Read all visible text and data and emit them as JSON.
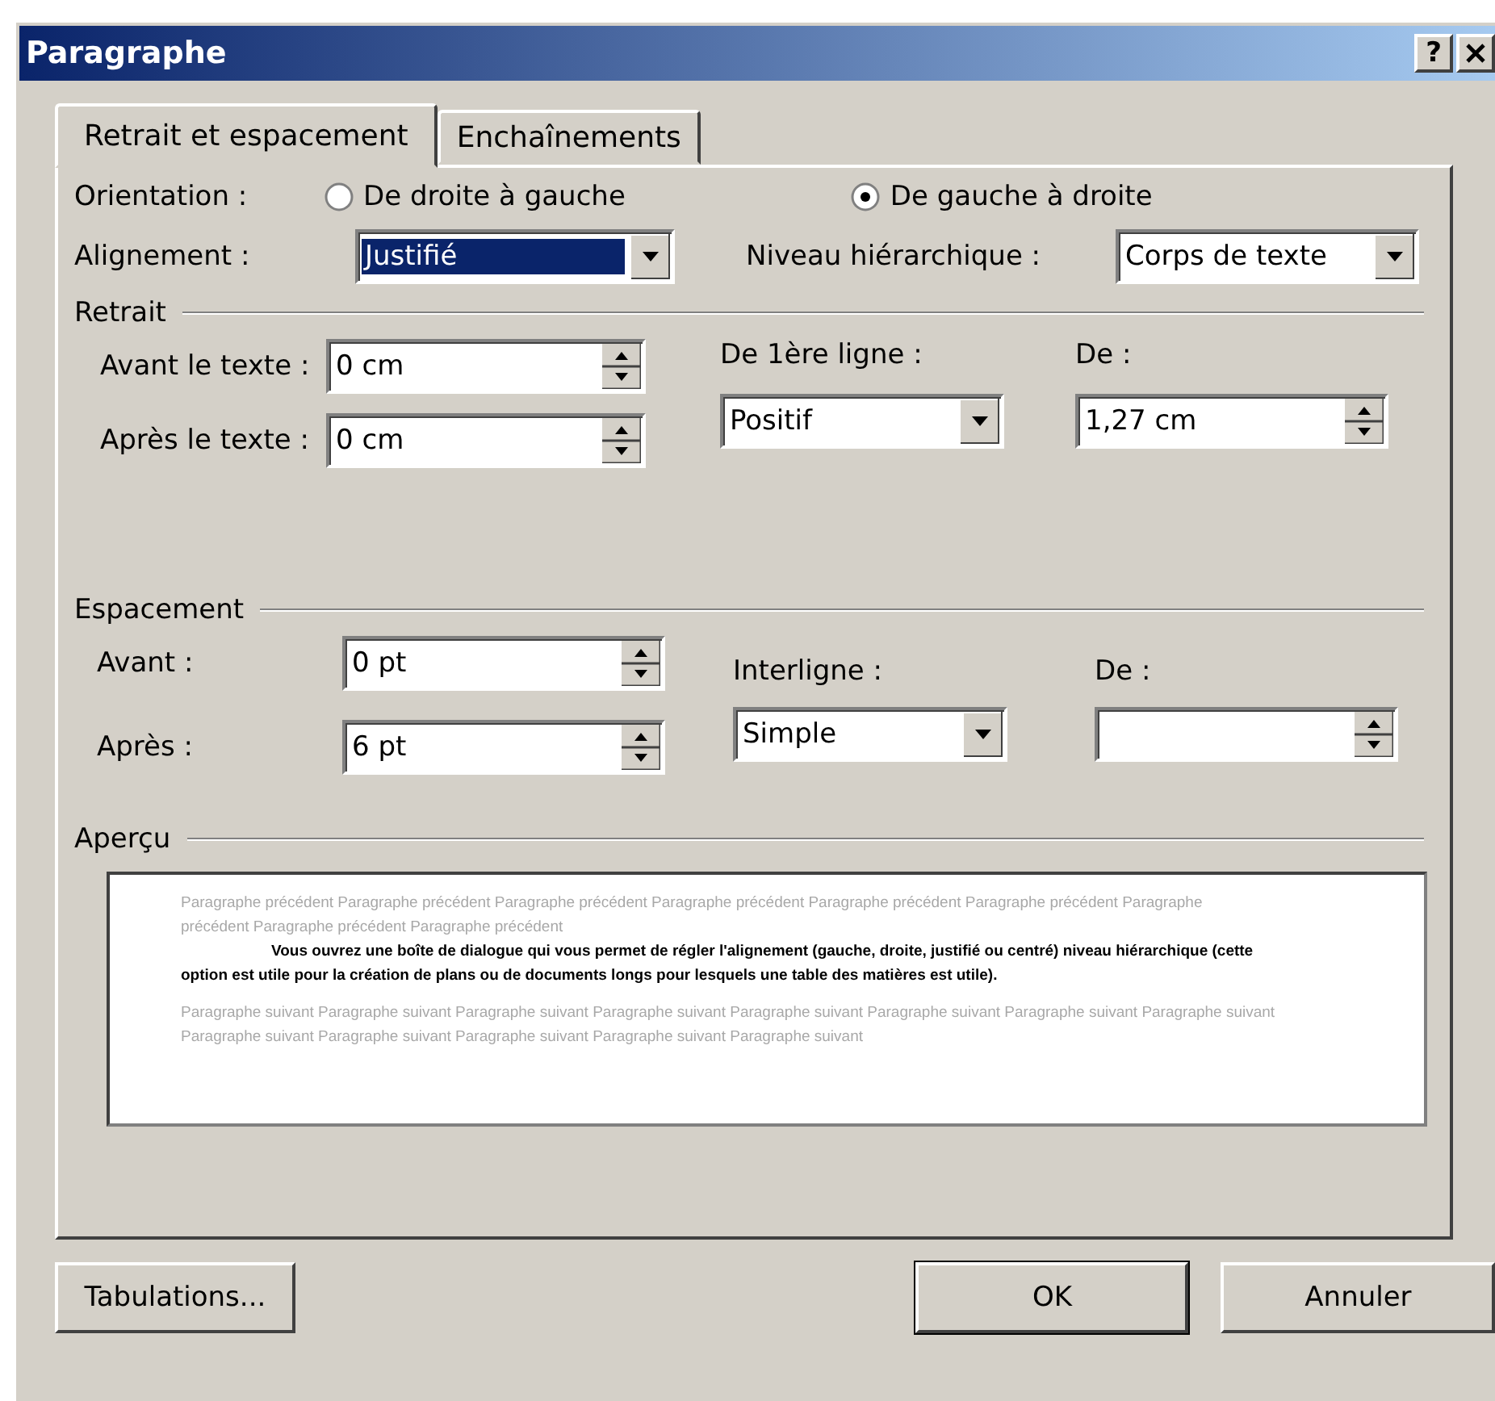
{
  "window": {
    "title": "Paragraphe",
    "help_button": "?"
  },
  "tabs": [
    {
      "label": "Retrait et espacement",
      "selected": true
    },
    {
      "label": "Enchaînements",
      "selected": false
    }
  ],
  "orientation": {
    "label": "Orientation :",
    "options": [
      {
        "label": "De droite à gauche",
        "selected": false
      },
      {
        "label": "De gauche à droite",
        "selected": true
      }
    ]
  },
  "alignment": {
    "label": "Alignement :",
    "value": "Justifié",
    "focused": true
  },
  "outline_level": {
    "label": "Niveau hiérarchique :",
    "value": "Corps de texte",
    "focused": false
  },
  "indentation": {
    "title": "Retrait",
    "before": {
      "label": "Avant le texte :",
      "value": "0 cm"
    },
    "after": {
      "label": "Après le texte :",
      "value": "0 cm"
    },
    "first_line": {
      "label": "De 1ère ligne :",
      "value": "Positif"
    },
    "by": {
      "label": "De :",
      "value": "1,27 cm"
    }
  },
  "spacing": {
    "title": "Espacement",
    "before": {
      "label": "Avant :",
      "value": "0 pt"
    },
    "after": {
      "label": "Après :",
      "value": "6 pt"
    },
    "line_spacing": {
      "label": "Interligne :",
      "value": "Simple"
    },
    "at": {
      "label": "De :"
    }
  },
  "preview": {
    "title": "Aperçu",
    "previous_text": "Paragraphe précédent Paragraphe précédent Paragraphe précédent Paragraphe précédent Paragraphe précédent Paragraphe précédent Paragraphe précédent Paragraphe précédent Paragraphe précédent",
    "sample_text": "Vous ouvrez une boîte de dialogue qui vous permet de régler l'alignement (gauche, droite, justifié ou centré) niveau hiérarchique (cette option est utile pour la création de plans ou de documents longs pour lesquels une table des matières est utile).",
    "next_text": "Paragraphe suivant Paragraphe suivant Paragraphe suivant Paragraphe suivant Paragraphe suivant Paragraphe suivant Paragraphe suivant Paragraphe suivant Paragraphe suivant Paragraphe suivant Paragraphe suivant Paragraphe suivant Paragraphe suivant"
  },
  "buttons": [
    {
      "label": "Tabulations...",
      "default": false
    },
    {
      "label": "OK",
      "default": true
    },
    {
      "label": "Annuler",
      "default": false
    }
  ]
}
